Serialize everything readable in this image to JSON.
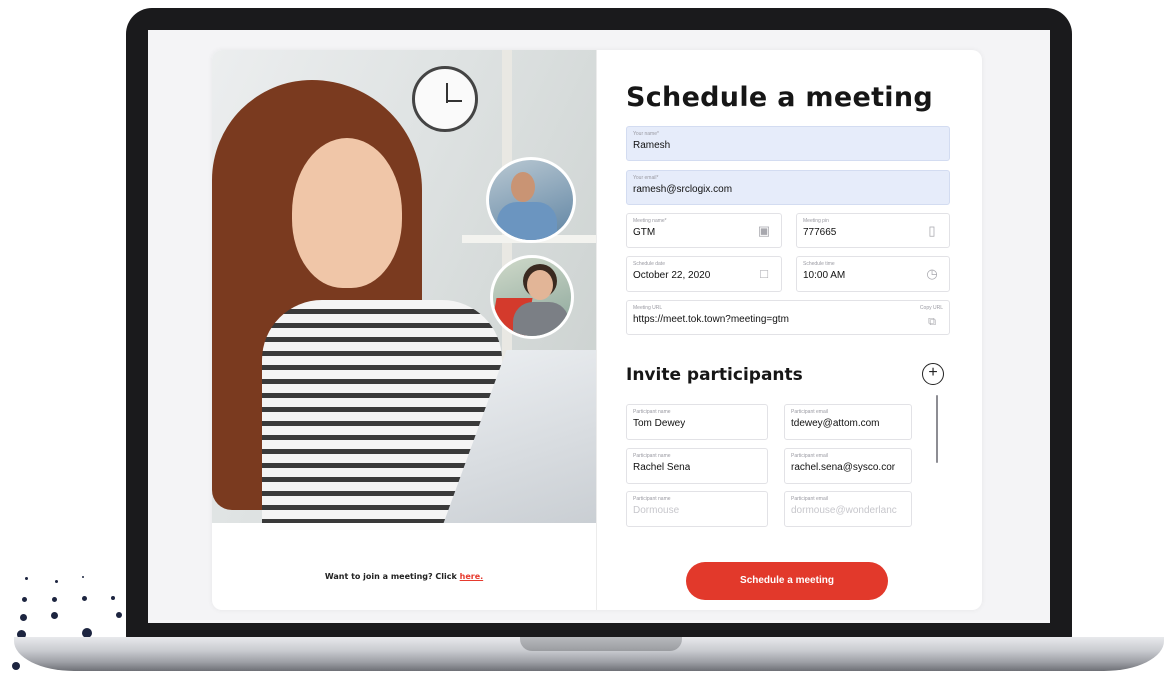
{
  "form": {
    "title": "Schedule a meeting",
    "your_name": {
      "label": "Your name*",
      "value": "Ramesh"
    },
    "your_email": {
      "label": "Your email*",
      "value": "ramesh@srclogix.com"
    },
    "meeting_name": {
      "label": "Meeting name*",
      "value": "GTM"
    },
    "meeting_pin": {
      "label": "Meeting pin",
      "value": "777665"
    },
    "schedule_date": {
      "label": "Schedule date",
      "value": "October 22, 2020"
    },
    "schedule_time": {
      "label": "Schedule time",
      "value": "10:00 AM"
    },
    "meeting_url": {
      "label": "Meeting URL",
      "value": "https://meet.tok.town?meeting=gtm",
      "copy_label": "Copy URL"
    }
  },
  "invite": {
    "title": "Invite participants",
    "add_icon": "plus-circle-icon",
    "participants": [
      {
        "name_label": "Participant name",
        "name": "Tom Dewey",
        "email_label": "Participant email",
        "email": "tdewey@attom.com"
      },
      {
        "name_label": "Participant name",
        "name": "Rachel Sena",
        "email_label": "Participant email",
        "email": "rachel.sena@sysco.cor"
      },
      {
        "name_label": "Participant name",
        "name": "Dormouse",
        "email_label": "Participant email",
        "email": "dormouse@wonderlanc"
      }
    ]
  },
  "footer": {
    "join_prefix": "Want to join a meeting? Click",
    "join_link": "here.",
    "schedule_button": "Schedule a meeting"
  },
  "colors": {
    "accent": "#e2392b",
    "filled_field": "#e6ecfa"
  }
}
